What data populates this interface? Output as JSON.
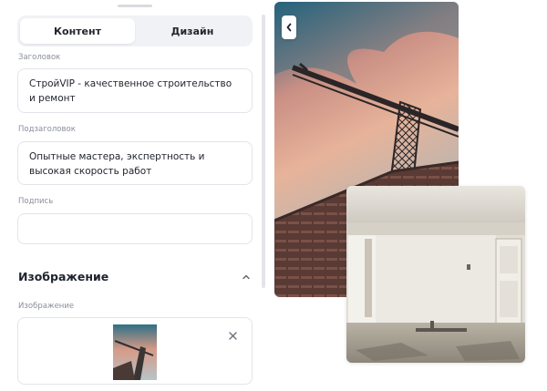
{
  "tabs": [
    {
      "label": "Контент",
      "active": true
    },
    {
      "label": "Дизайн",
      "active": false
    }
  ],
  "fields": {
    "title": {
      "label": "Заголовок",
      "value": "СтройVIP - качественное строительство и ремонт"
    },
    "subtitle": {
      "label": "Подзаголовок",
      "value": "Опытные мастера, экспертность и высокая скорость работ"
    },
    "caption": {
      "label": "Подпись",
      "value": ""
    }
  },
  "image_section": {
    "title": "Изображение",
    "field_label": "Изображение",
    "icons": {
      "toggle": "chevron-up-icon",
      "remove": "close-icon"
    }
  },
  "preview": {
    "collapse_icon": "chevron-left-icon",
    "images": [
      "crane-photo",
      "room-photo"
    ]
  },
  "colors": {
    "panel_bg": "#ffffff",
    "tab_track": "#f1f2f5",
    "field_border": "#e2e4ea",
    "label_text": "#8a8f9c",
    "primary_text": "#1f2330"
  }
}
